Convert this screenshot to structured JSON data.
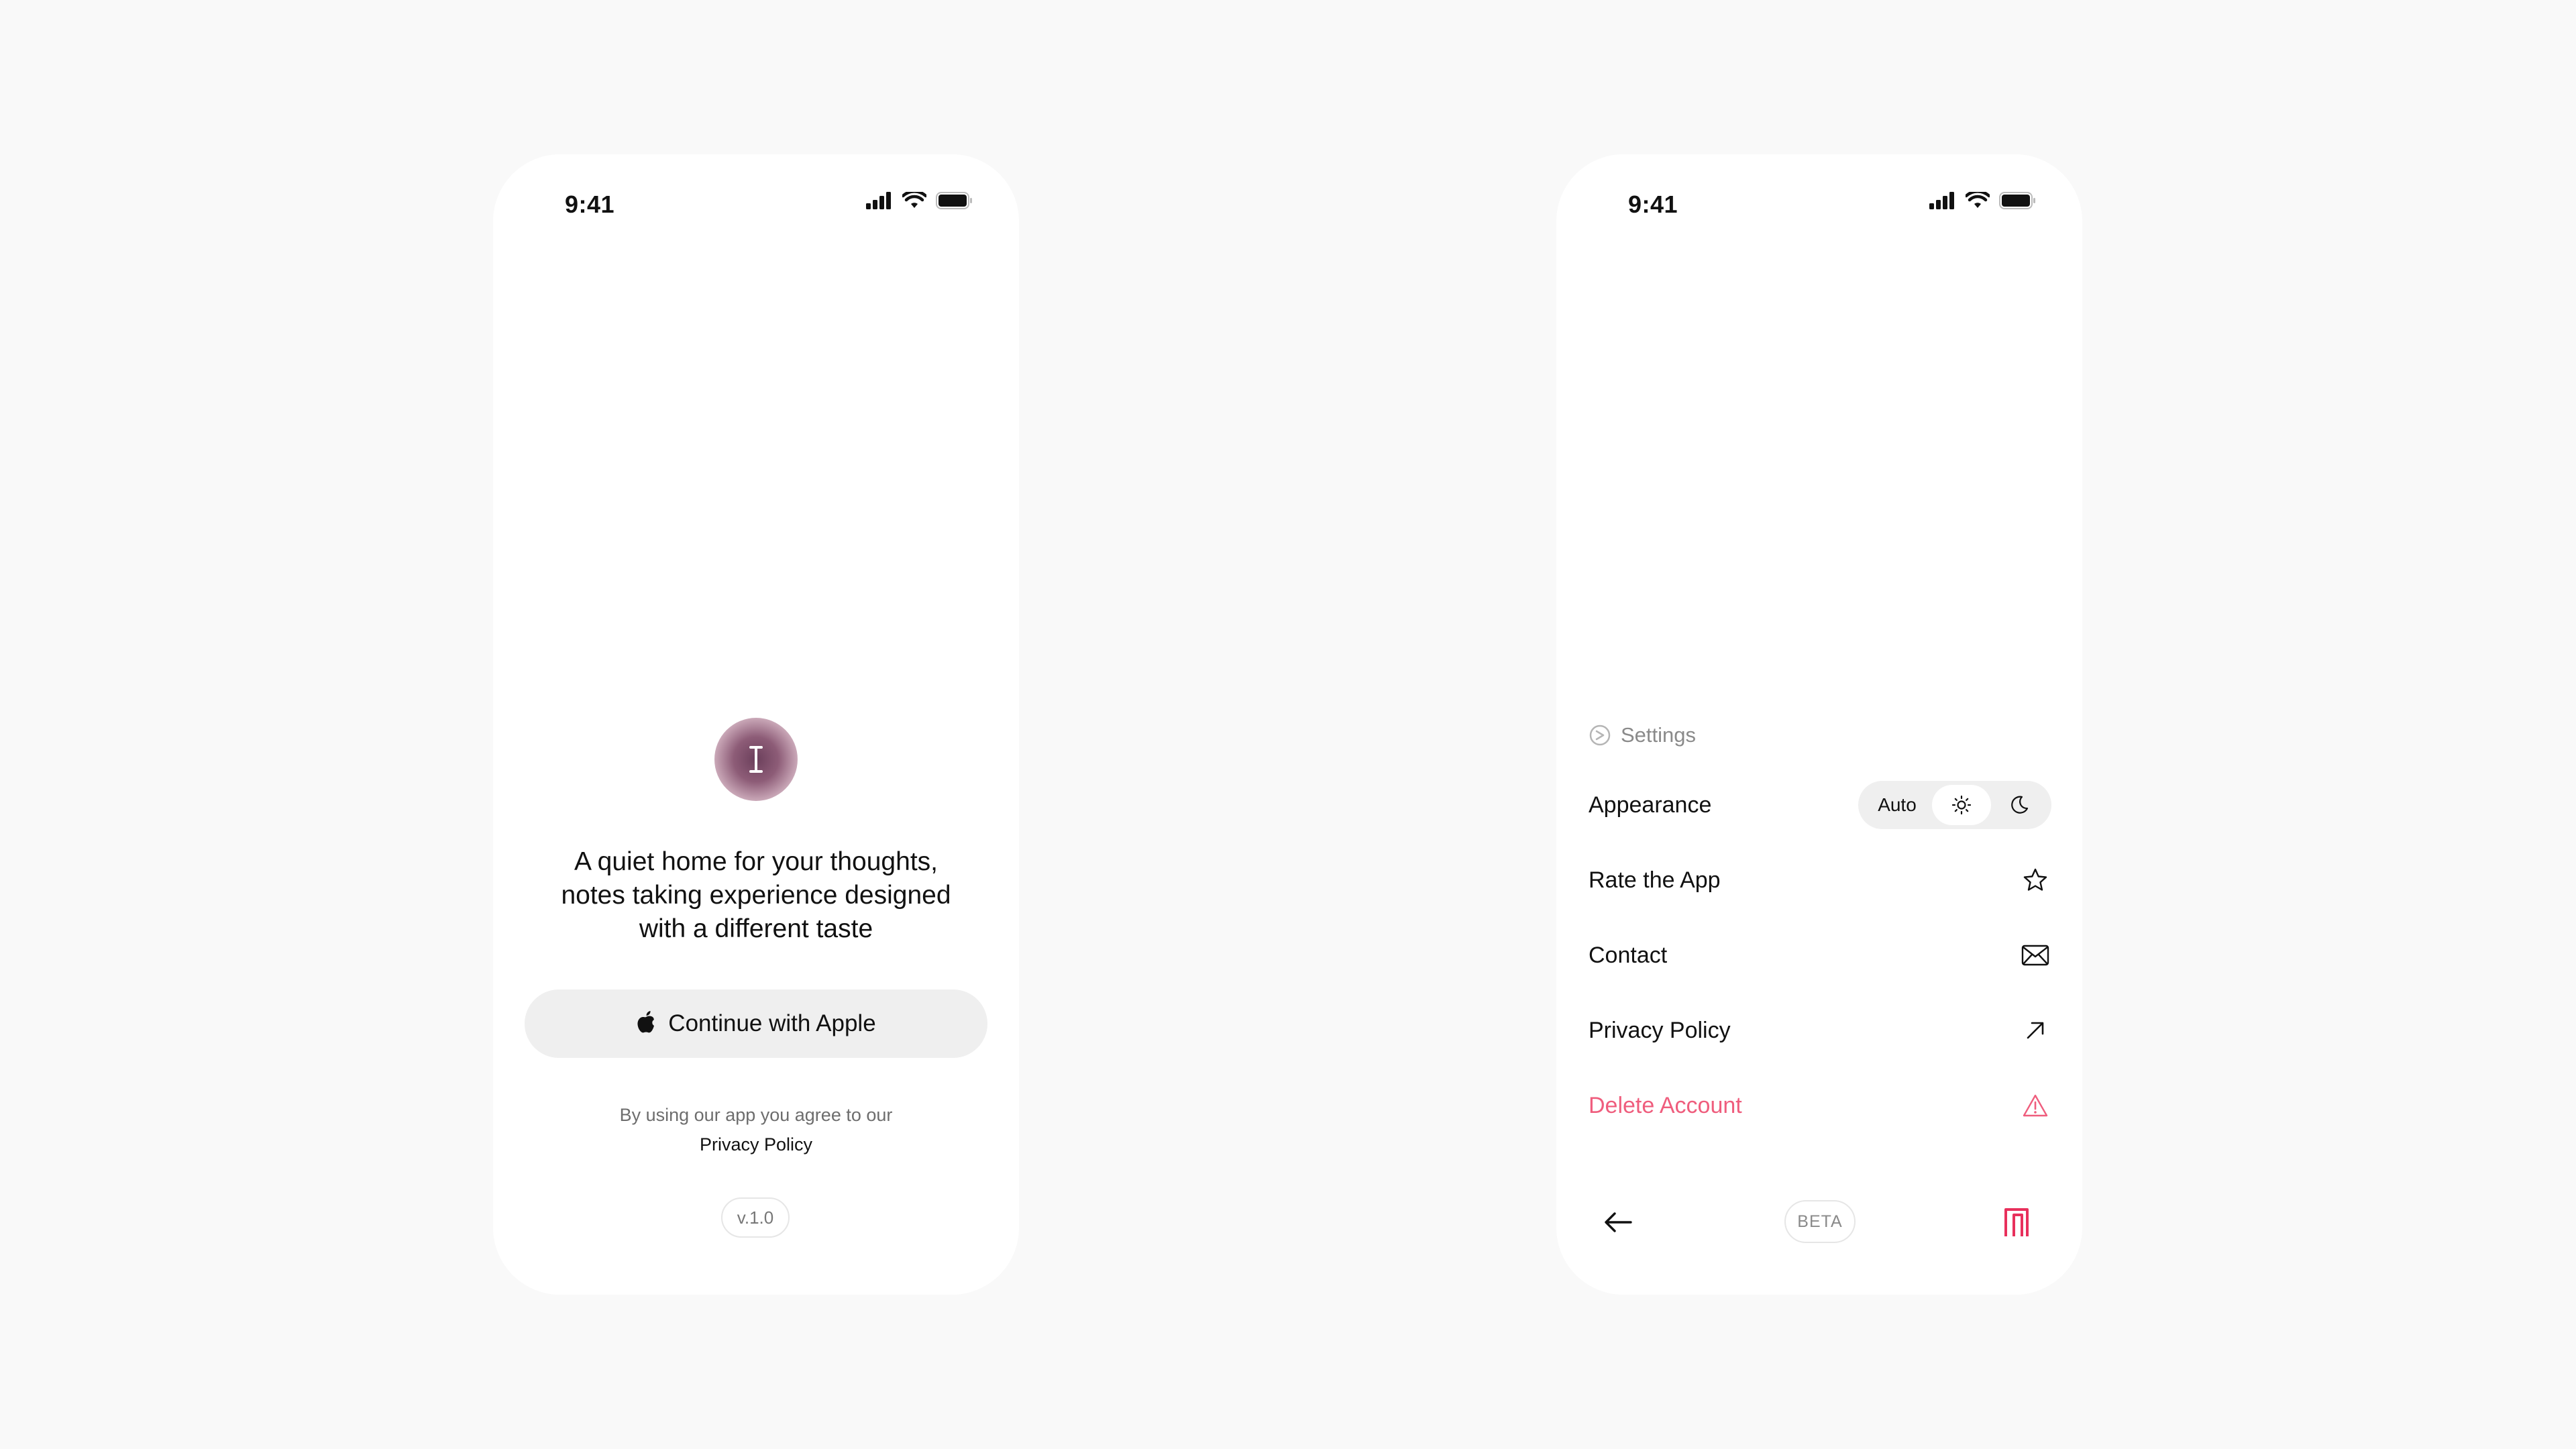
{
  "colors": {
    "background": "#f9f9f9",
    "phone": "#ffffff",
    "danger": "#ef5d7d",
    "brand": "#e8305c",
    "pill": "#efefef"
  },
  "onboarding": {
    "status_time": "9:41",
    "logo_letter": "I",
    "tagline_line1": "A quiet home for your thoughts,",
    "tagline_line2": "notes taking experience designed",
    "tagline_line3": "with a different taste",
    "apple_button_label": "Continue with Apple",
    "legal_text": "By using our app you agree to our",
    "legal_link": "Privacy Policy",
    "version": "v.1.0"
  },
  "settings": {
    "status_time": "9:41",
    "header": "Settings",
    "appearance": {
      "label": "Appearance",
      "options": [
        "Auto",
        "sun-icon",
        "moon-icon"
      ],
      "auto_label": "Auto",
      "selected": "sun-icon"
    },
    "items": [
      {
        "label": "Rate the App",
        "icon": "star-icon"
      },
      {
        "label": "Contact",
        "icon": "mail-icon"
      },
      {
        "label": "Privacy Policy",
        "icon": "arrow-up-right-icon"
      },
      {
        "label": "Delete Account",
        "icon": "warning-icon"
      }
    ],
    "bottom": {
      "back_icon": "arrow-left-icon",
      "beta_label": "BETA",
      "brand_icon": "app-brand-icon"
    }
  }
}
